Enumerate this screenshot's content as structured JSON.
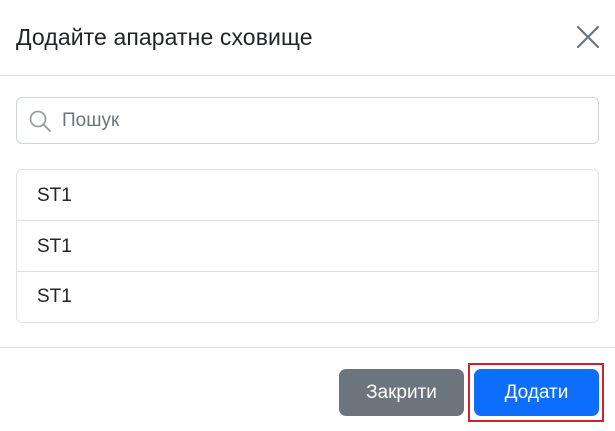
{
  "dialog": {
    "title": "Додайте апаратне сховище",
    "close_icon": "close-icon"
  },
  "search": {
    "placeholder": "Пошук",
    "value": "",
    "icon": "search-icon"
  },
  "storage_list": {
    "items": [
      {
        "label": "ST1"
      },
      {
        "label": "ST1"
      },
      {
        "label": "ST1"
      }
    ]
  },
  "footer": {
    "close_label": "Закрити",
    "add_label": "Додати"
  },
  "colors": {
    "primary": "#0d6efd",
    "secondary": "#6c757d",
    "highlight": "#d0202a",
    "text": "#212529",
    "border": "#dee2e6"
  }
}
